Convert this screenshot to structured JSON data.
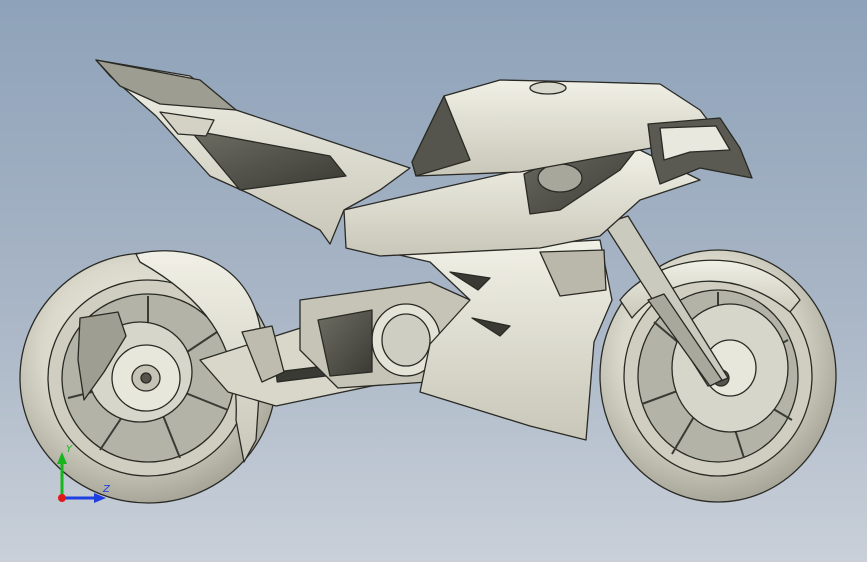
{
  "viewport": {
    "background_top": "#8ea2b9",
    "background_bottom": "#c9d0d9",
    "model_fill": "#e3e2d6",
    "model_edge": "#2a2a25",
    "model_shade": "#b9b8aa"
  },
  "triad": {
    "x_label": "Z",
    "y_label": "Y",
    "x_color": "#1f3fe0",
    "y_color": "#19b51e",
    "origin_color": "#e01a1a"
  }
}
